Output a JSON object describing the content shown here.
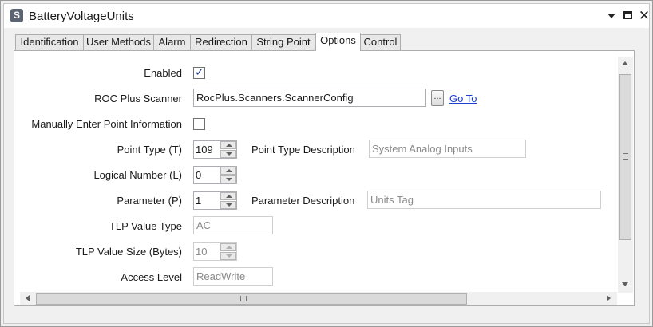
{
  "window": {
    "app_icon_letter": "S",
    "title": "BatteryVoltageUnits",
    "icons": {
      "minimize": "chevron-down-icon",
      "maximize": "maximize-icon",
      "close": "close-icon"
    },
    "close_glyph": "✕"
  },
  "tabs": [
    {
      "label": "Identification",
      "active": false
    },
    {
      "label": "User Methods",
      "active": false
    },
    {
      "label": "Alarm",
      "active": false
    },
    {
      "label": "Redirection",
      "active": false
    },
    {
      "label": "String Point",
      "active": false
    },
    {
      "label": "Options",
      "active": true
    },
    {
      "label": "Control",
      "active": false
    }
  ],
  "form": {
    "enabled": {
      "label": "Enabled",
      "checked": true,
      "mark": "✓"
    },
    "roc_plus_scanner": {
      "label": "ROC Plus Scanner",
      "value": "RocPlus.Scanners.ScannerConfig",
      "browse_label": "...",
      "goto_label": "Go To"
    },
    "manual_entry": {
      "label": "Manually Enter Point Information",
      "checked": false
    },
    "point_type": {
      "label": "Point Type (T)",
      "value": "109",
      "desc_label": "Point Type Description",
      "desc_value": "System Analog Inputs"
    },
    "logical_number": {
      "label": "Logical Number (L)",
      "value": "0"
    },
    "parameter": {
      "label": "Parameter (P)",
      "value": "1",
      "desc_label": "Parameter Description",
      "desc_value": "Units Tag"
    },
    "tlp_value_type": {
      "label": "TLP Value Type",
      "value": "AC"
    },
    "tlp_value_size": {
      "label": "TLP Value Size (Bytes)",
      "value": "10"
    },
    "access_level": {
      "label": "Access Level",
      "value": "ReadWrite"
    }
  },
  "colors": {
    "link": "#1a3fd1",
    "checkmark": "#1f3c88",
    "disabled_text": "#8a8a8a"
  }
}
